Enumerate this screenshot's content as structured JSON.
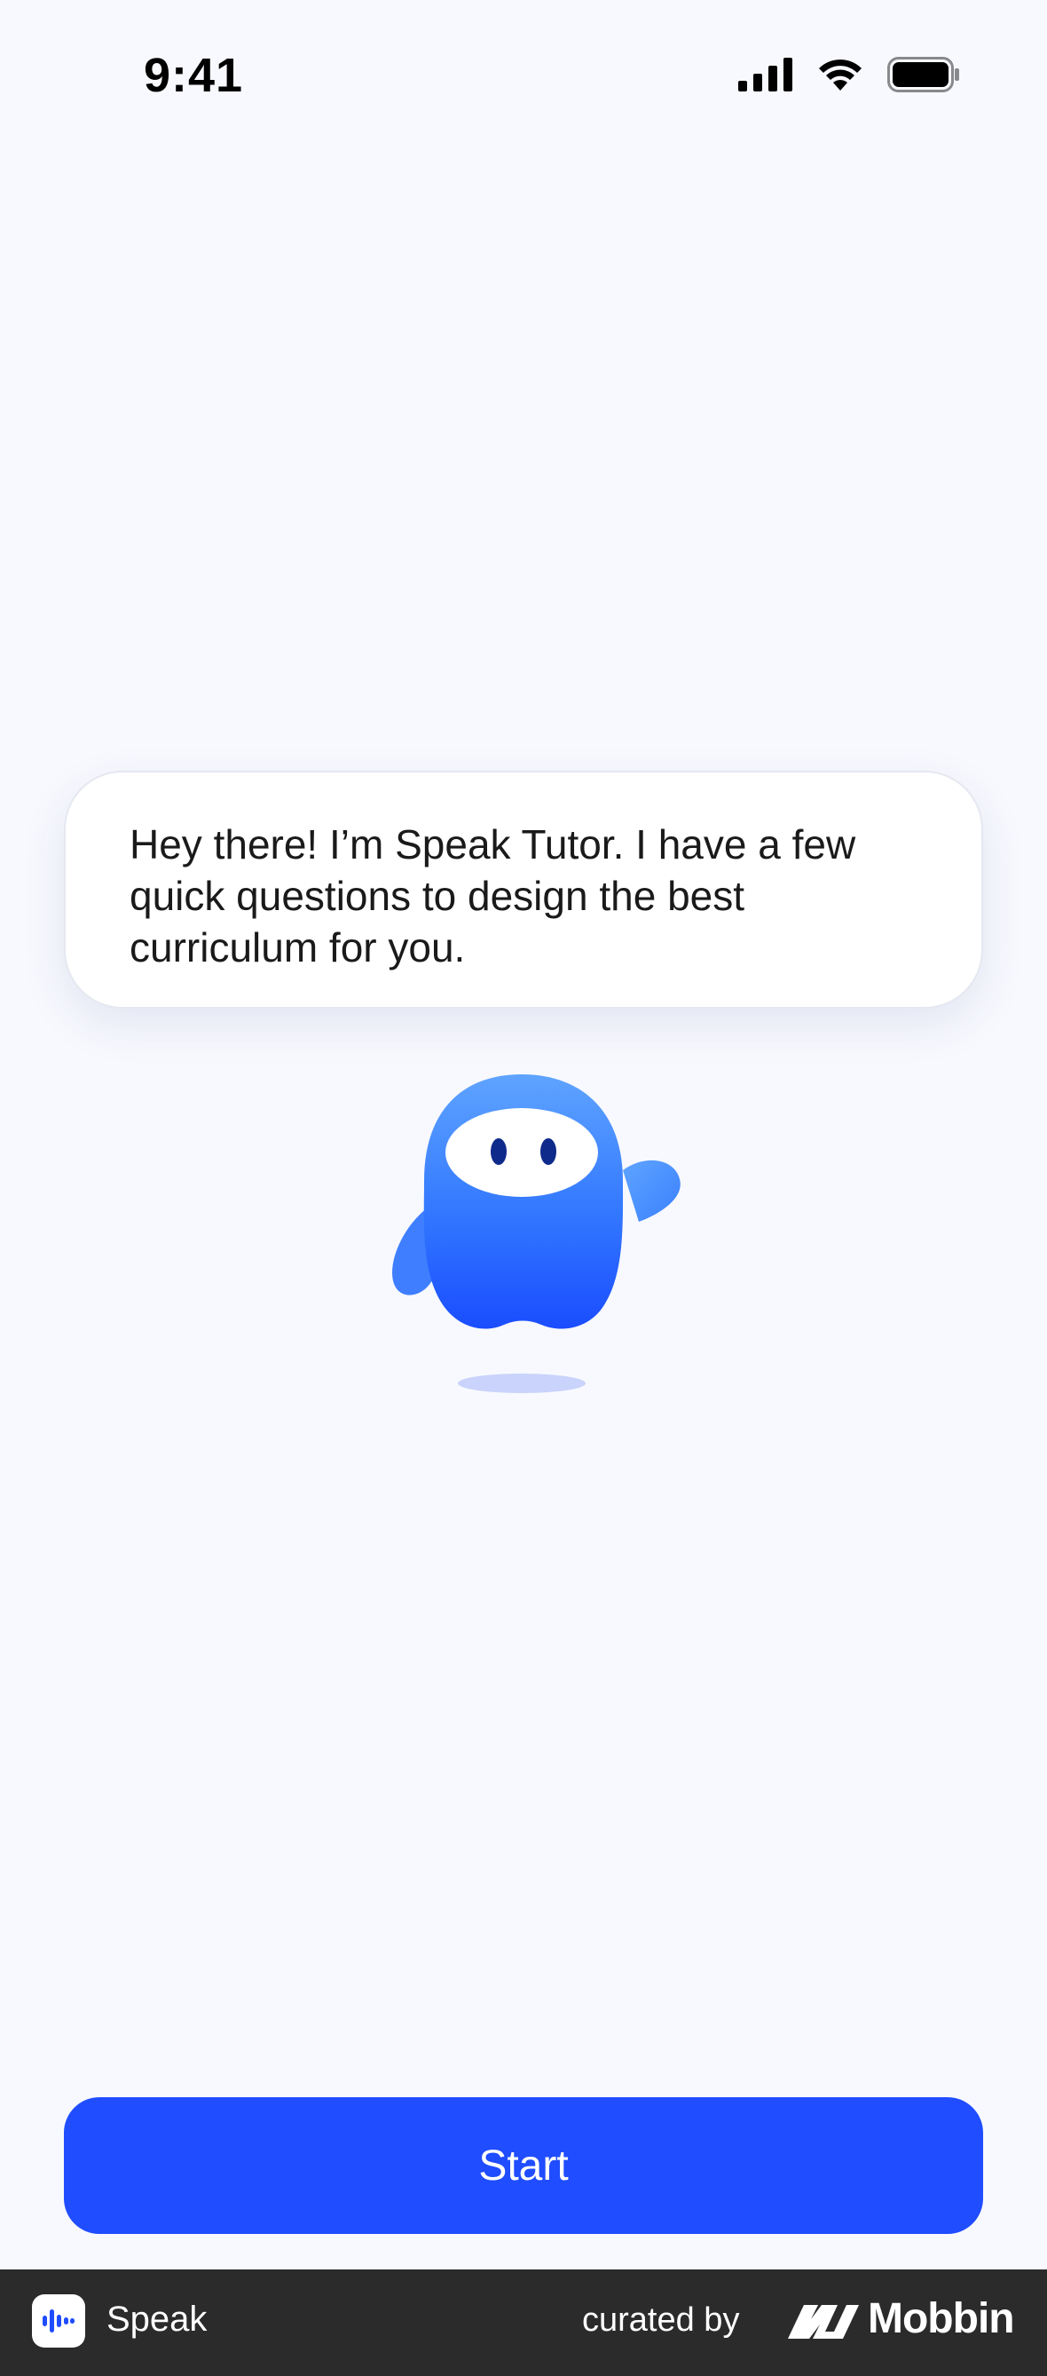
{
  "status_bar": {
    "time": "9:41",
    "icons": [
      "cellular-signal-icon",
      "wifi-icon",
      "battery-icon"
    ]
  },
  "tutor": {
    "message": "Hey there! I’m Speak Tutor. I have a few quick questions to design the best curriculum for you.",
    "mascot": "speak-tutor-mascot"
  },
  "actions": {
    "start_label": "Start"
  },
  "footer": {
    "app_name": "Speak",
    "curated_by": "curated by",
    "brand": "Mobbin"
  },
  "colors": {
    "background": "#f8f9fe",
    "accent": "#1f4dff",
    "footer": "#2b2b2b"
  }
}
